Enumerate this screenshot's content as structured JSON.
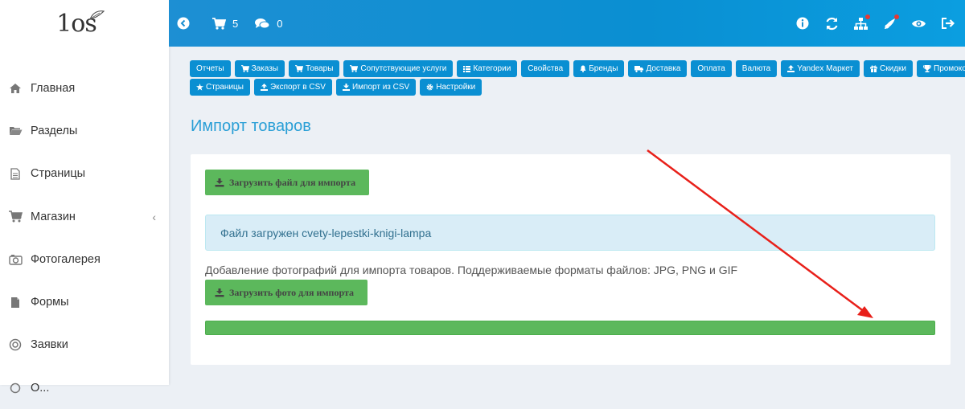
{
  "logo": {
    "text": "1os"
  },
  "sidebar": {
    "items": [
      {
        "label": "Главная",
        "icon": "home-icon"
      },
      {
        "label": "Разделы",
        "icon": "folder-open-icon"
      },
      {
        "label": "Страницы",
        "icon": "file-outline-icon"
      },
      {
        "label": "Магазин",
        "icon": "cart-icon",
        "chevron": "‹"
      },
      {
        "label": "Фотогалерея",
        "icon": "camera-icon"
      },
      {
        "label": "Формы",
        "icon": "file-icon"
      },
      {
        "label": "Заявки",
        "icon": "target-icon"
      },
      {
        "label": "О...",
        "icon": "dot-icon"
      }
    ]
  },
  "topbar": {
    "cart_count": "5",
    "comments_count": "0",
    "right_icons": [
      "info-icon",
      "refresh-icon",
      "sitemap-icon",
      "rocket-icon",
      "eye-icon",
      "logout-icon"
    ]
  },
  "nav_buttons": {
    "row1": [
      {
        "label": "Отчеты",
        "icon": ""
      },
      {
        "label": "Заказы",
        "icon": "cart-icon"
      },
      {
        "label": "Товары",
        "icon": "cart-icon"
      },
      {
        "label": "Сопутствующие услуги",
        "icon": "cart-icon"
      },
      {
        "label": "Категории",
        "icon": "list-icon"
      },
      {
        "label": "Свойства",
        "icon": ""
      },
      {
        "label": "Бренды",
        "icon": "bell-icon"
      },
      {
        "label": "Доставка",
        "icon": "truck-icon"
      },
      {
        "label": "Оплата",
        "icon": ""
      },
      {
        "label": "Валюта",
        "icon": ""
      },
      {
        "label": "Yandex Маркет",
        "icon": "upload-icon"
      },
      {
        "label": "Скидки",
        "icon": "gift-icon"
      },
      {
        "label": "Промокоды",
        "icon": "trophy-icon"
      }
    ],
    "row2": [
      {
        "label": "Страницы",
        "icon": "star-icon"
      },
      {
        "label": "Экспорт в CSV",
        "icon": "upload-icon"
      },
      {
        "label": "Импорт из CSV",
        "icon": "download-icon"
      },
      {
        "label": "Настройки",
        "icon": "gear-icon"
      }
    ]
  },
  "page": {
    "title": "Импорт товаров",
    "upload_file_button": "Загрузить файл для импорта",
    "alert_text": "Файл загружен cvety-lepestki-knigi-lampa",
    "help_text": "Добавление фотографий для импорта товаров. Поддерживаемые форматы файлов: JPG, PNG и GIF",
    "upload_photo_button": "Загрузить фото для импорта",
    "progress_percent": 100
  },
  "colors": {
    "accent": "#0a8fd2",
    "success": "#5cb85c",
    "title": "#2a9fd6",
    "annotation_arrow": "#e8201a"
  }
}
